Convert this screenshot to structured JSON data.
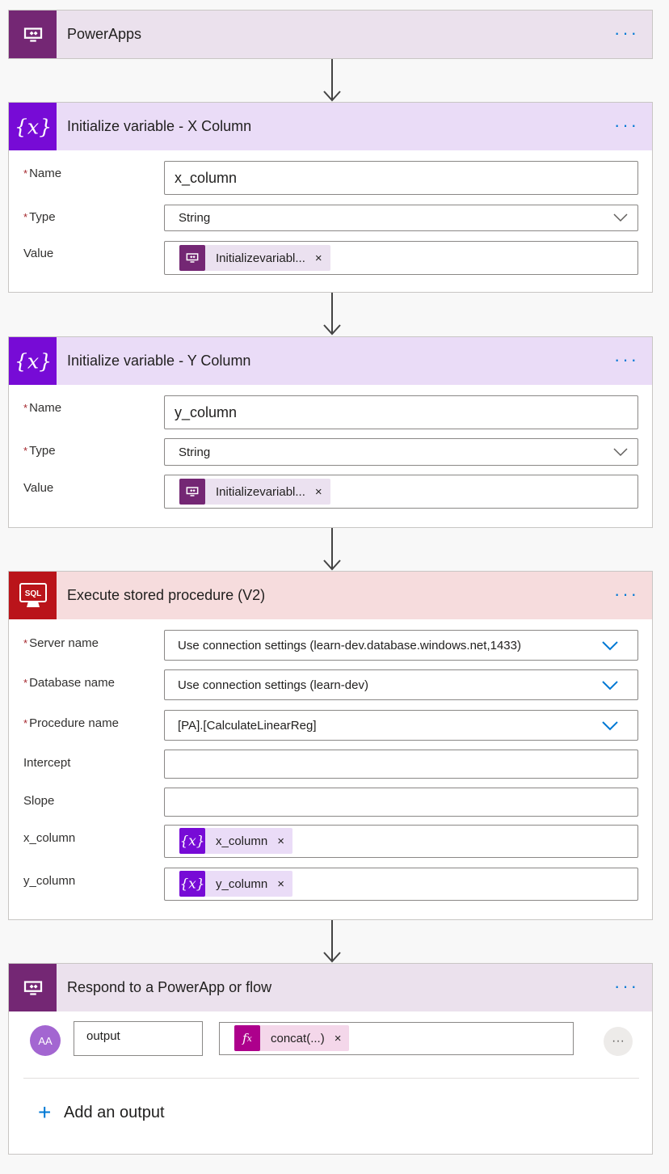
{
  "steps": {
    "powerapps": {
      "title": "PowerApps",
      "more": "···"
    },
    "init_x": {
      "title": "Initialize variable - X Column",
      "more": "···",
      "name_label": "Name",
      "name_value": "x_column",
      "type_label": "Type",
      "type_value": "String",
      "value_label": "Value",
      "value_token": "Initializevariabl...",
      "required_mark": "*",
      "remove": "×"
    },
    "init_y": {
      "title": "Initialize variable - Y Column",
      "more": "···",
      "name_label": "Name",
      "name_value": "y_column",
      "type_label": "Type",
      "type_value": "String",
      "value_label": "Value",
      "value_token": "Initializevariabl...",
      "required_mark": "*",
      "remove": "×"
    },
    "sql": {
      "title": "Execute stored procedure (V2)",
      "more": "···",
      "icon_text": "SQL",
      "required_mark": "*",
      "server_label": "Server name",
      "server_value": "Use connection settings (learn-dev.database.windows.net,1433)",
      "db_label": "Database name",
      "db_value": "Use connection settings (learn-dev)",
      "proc_label": "Procedure name",
      "proc_value": "[PA].[CalculateLinearReg]",
      "intercept_label": "Intercept",
      "slope_label": "Slope",
      "x_label": "x_column",
      "x_token": "x_column",
      "y_label": "y_column",
      "y_token": "y_column",
      "remove": "×"
    },
    "respond": {
      "title": "Respond to a PowerApp or flow",
      "more": "···",
      "avatar_text": "AA",
      "output_name": "output",
      "output_token": "concat(...)",
      "remove": "×",
      "row_more": "···",
      "add_plus": "+",
      "add_label": "Add an output"
    }
  },
  "colors": {
    "powerapps_brand": "#742774",
    "powerapps_header_bg": "#ebe1ed",
    "variable_brand": "#770bd6",
    "variable_header_bg": "#eadcf7",
    "sql_brand": "#ba141a",
    "sql_header_bg": "#f6dcdd",
    "expression_brand": "#ad008c",
    "link_blue": "#0078d4"
  },
  "icons": {
    "powerapps": "powerapps-icon",
    "variable": "variable-icon",
    "sql": "sql-server-icon",
    "expression": "fx-icon",
    "arrow": "arrow-down-icon",
    "chevron": "chevron-down-icon",
    "plus": "plus-icon"
  }
}
